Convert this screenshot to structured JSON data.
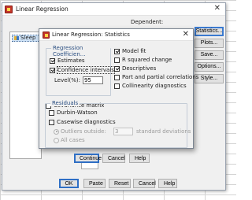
{
  "outer": {
    "title": "Linear Regression",
    "close_glyph": "✕",
    "dependent_label": "Dependent:",
    "variables": [
      "Sleep"
    ],
    "side_buttons": [
      "Statistics...",
      "Plots...",
      "Save...",
      "Options...",
      "Style..."
    ],
    "bottom_buttons": [
      "OK",
      "Paste",
      "Reset",
      "Cancel",
      "Help"
    ]
  },
  "inner": {
    "title": "Linear Regression: Statistics",
    "close_glyph": "✕",
    "reg_coeff_title": "Regression Coefficien...",
    "estimates_label": "Estimates",
    "confidence_label": "Confidence intervals",
    "level_label": "Level(%):",
    "level_value": "95",
    "covariance_label": "Covariance matrix",
    "model_fit_label": "Model fit",
    "r_squared_label": "R squared change",
    "descriptives_label": "Descriptives",
    "part_partial_label": "Part and partial correlations",
    "collinearity_label": "Collinearity diagnostics",
    "residuals_title": "Residuals",
    "durbin_label": "Durbin-Watson",
    "casewise_label": "Casewise diagnostics",
    "outliers_label": "Outliers outside:",
    "outliers_value": "3",
    "std_label": "standard deviations",
    "all_cases_label": "All cases",
    "buttons": [
      "Continue",
      "Cancel",
      "Help"
    ]
  },
  "checks": {
    "estimates": true,
    "confidence": true,
    "covariance": false,
    "model_fit": true,
    "r_squared": false,
    "descriptives": true,
    "part_partial": false,
    "collinearity": false,
    "durbin": false,
    "casewise": false
  },
  "colors": {
    "group_title": "#2b4f82",
    "focus_border": "#2f6fc5",
    "selection": "#cfe3f7"
  }
}
